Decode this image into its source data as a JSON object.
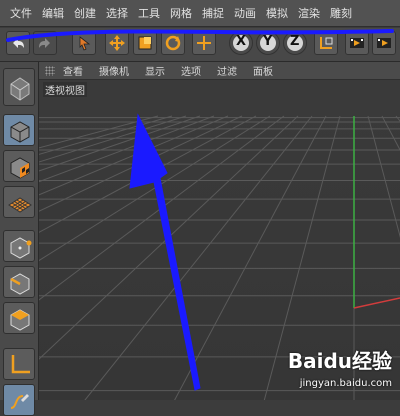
{
  "menu": {
    "items": [
      "文件",
      "编辑",
      "创建",
      "选择",
      "工具",
      "网格",
      "捕捉",
      "动画",
      "模拟",
      "渲染",
      "雕刻"
    ]
  },
  "toolbar": {
    "buttons": [
      "undo-icon",
      "redo-icon",
      "live-select-icon",
      "move-icon",
      "scale-icon",
      "rotate-icon",
      "add-icon",
      "x-axis-icon",
      "y-axis-icon",
      "z-axis-icon",
      "world-coordinate-icon",
      "render-view-icon",
      "render-picture-icon",
      "render-settings-icon"
    ],
    "axis_labels": {
      "x": "X",
      "y": "Y",
      "z": "Z"
    }
  },
  "viewport": {
    "menus": [
      "查看",
      "摄像机",
      "显示",
      "选项",
      "过滤",
      "面板"
    ],
    "label": "透视视图",
    "grid_color": "#5a5a5a",
    "axis_green": "#3cb043",
    "axis_red": "#d23c3c"
  },
  "palette": {
    "tools": [
      "make-editable-icon",
      "model-mode-icon",
      "texture-mode-icon",
      "workplane-icon",
      "points-mode-icon",
      "edges-mode-icon",
      "polygons-mode-icon",
      "axis-mode-icon",
      "tweak-mode-icon"
    ]
  },
  "annotations": {
    "color": "#1a1aff"
  },
  "watermark": {
    "brand": "Baidu经验",
    "url": "jingyan.baidu.com"
  }
}
